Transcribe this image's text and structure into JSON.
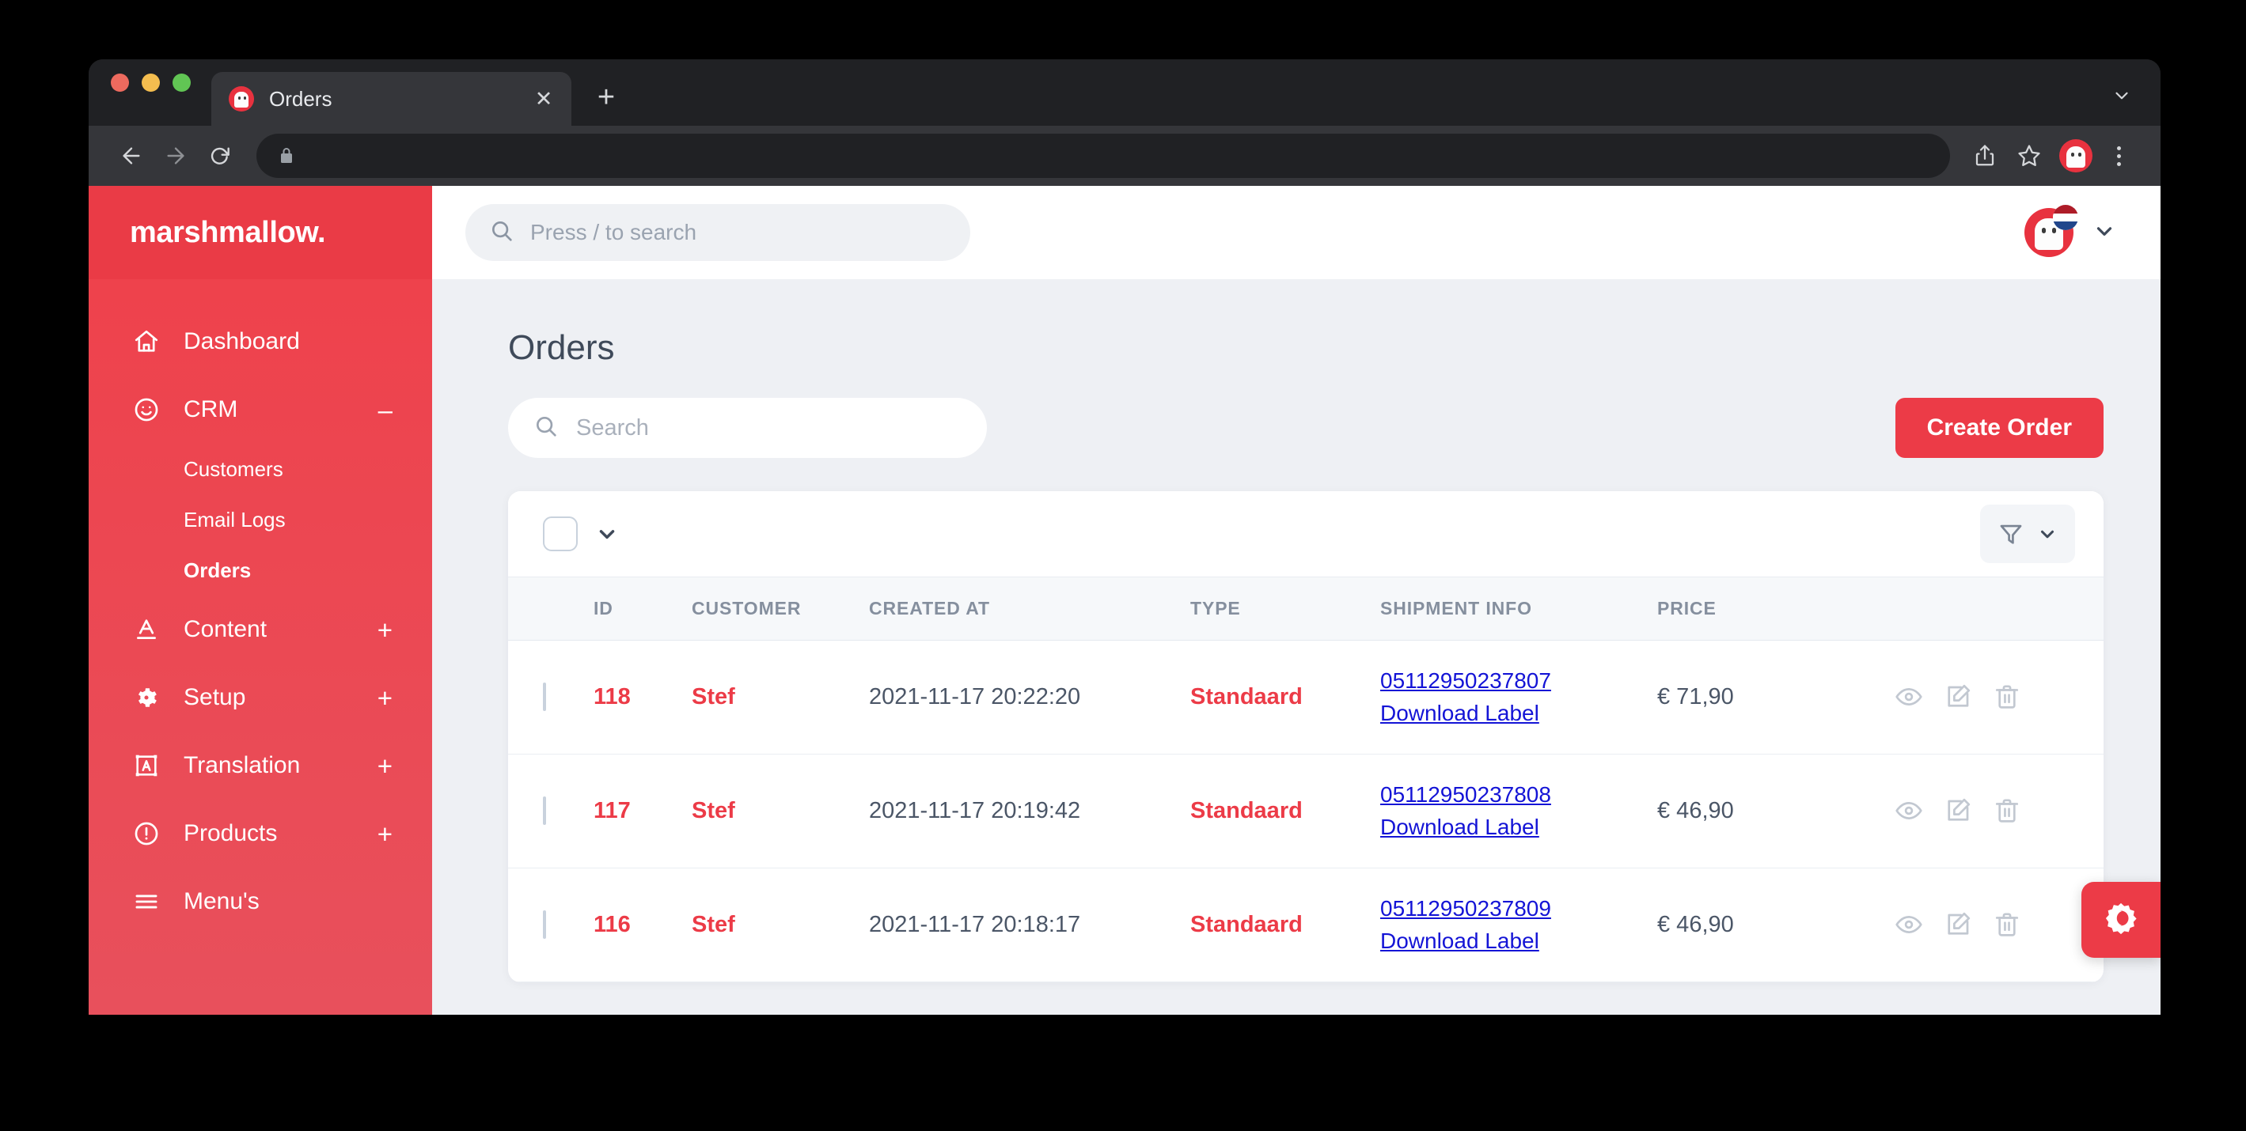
{
  "browser": {
    "tab": {
      "title": "Orders",
      "favicon": "marshmallow-mascot-icon",
      "close_label": "✕"
    },
    "new_tab_label": "+",
    "nav": {
      "back": "back-arrow-icon",
      "forward": "forward-arrow-icon",
      "reload": "reload-icon"
    },
    "address_bar": {
      "value": "",
      "lock": "lock-icon"
    },
    "toolbar_icons": [
      "share-icon",
      "bookmark-star-icon",
      "profile-avatar",
      "kebab-menu-icon"
    ]
  },
  "sidebar": {
    "brand": "marshmallow.",
    "items": [
      {
        "label": "Dashboard",
        "icon": "home-icon",
        "expander": ""
      },
      {
        "label": "CRM",
        "icon": "smiley-face-icon",
        "expander": "–"
      },
      {
        "label": "Content",
        "icon": "text-format-icon",
        "expander": "+"
      },
      {
        "label": "Setup",
        "icon": "gear-icon",
        "expander": "+"
      },
      {
        "label": "Translation",
        "icon": "translate-icon",
        "expander": "+"
      },
      {
        "label": "Products",
        "icon": "exclamation-circle-icon",
        "expander": "+"
      },
      {
        "label": "Menu's",
        "icon": "hamburger-icon",
        "expander": ""
      }
    ],
    "crm_subitems": [
      {
        "label": "Customers",
        "active": false
      },
      {
        "label": "Email Logs",
        "active": false
      },
      {
        "label": "Orders",
        "active": true
      }
    ]
  },
  "topbar": {
    "search_placeholder": "Press / to search",
    "search_value": "",
    "search_icon": "search-icon",
    "avatar": "marshmallow-avatar",
    "flag": "netherlands-flag",
    "chevron": "chevron-down-icon"
  },
  "main": {
    "title": "Orders",
    "search_placeholder": "Search",
    "search_value": "",
    "create_button": "Create Order"
  },
  "table": {
    "select_all_checked": false,
    "filter_icon": "filter-funnel-icon",
    "columns": [
      "ID",
      "CUSTOMER",
      "CREATED AT",
      "TYPE",
      "SHIPMENT INFO",
      "PRICE"
    ],
    "download_label_text": "Download Label",
    "row_actions": [
      "eye-icon",
      "edit-icon",
      "trash-icon"
    ],
    "rows": [
      {
        "id": "118",
        "customer": "Stef",
        "created_at": "2021-11-17 20:22:20",
        "type": "Standaard",
        "tracking": "05112950237807",
        "download": "Download Label",
        "price": "€ 71,90"
      },
      {
        "id": "117",
        "customer": "Stef",
        "created_at": "2021-11-17 20:19:42",
        "type": "Standaard",
        "tracking": "05112950237808",
        "download": "Download Label",
        "price": "€ 46,90"
      },
      {
        "id": "116",
        "customer": "Stef",
        "created_at": "2021-11-17 20:18:17",
        "type": "Standaard",
        "tracking": "05112950237809",
        "download": "Download Label",
        "price": "€ 46,90"
      }
    ]
  },
  "dark_mode_toggle": {
    "icon": "brightness-contrast-icon"
  },
  "colors": {
    "brand_red": "#ec3b47",
    "sidebar_header_red": "#ea3b46",
    "link_blue": "#1414d6",
    "page_bg": "#eef0f4",
    "text_dark": "#3f4a5a"
  }
}
